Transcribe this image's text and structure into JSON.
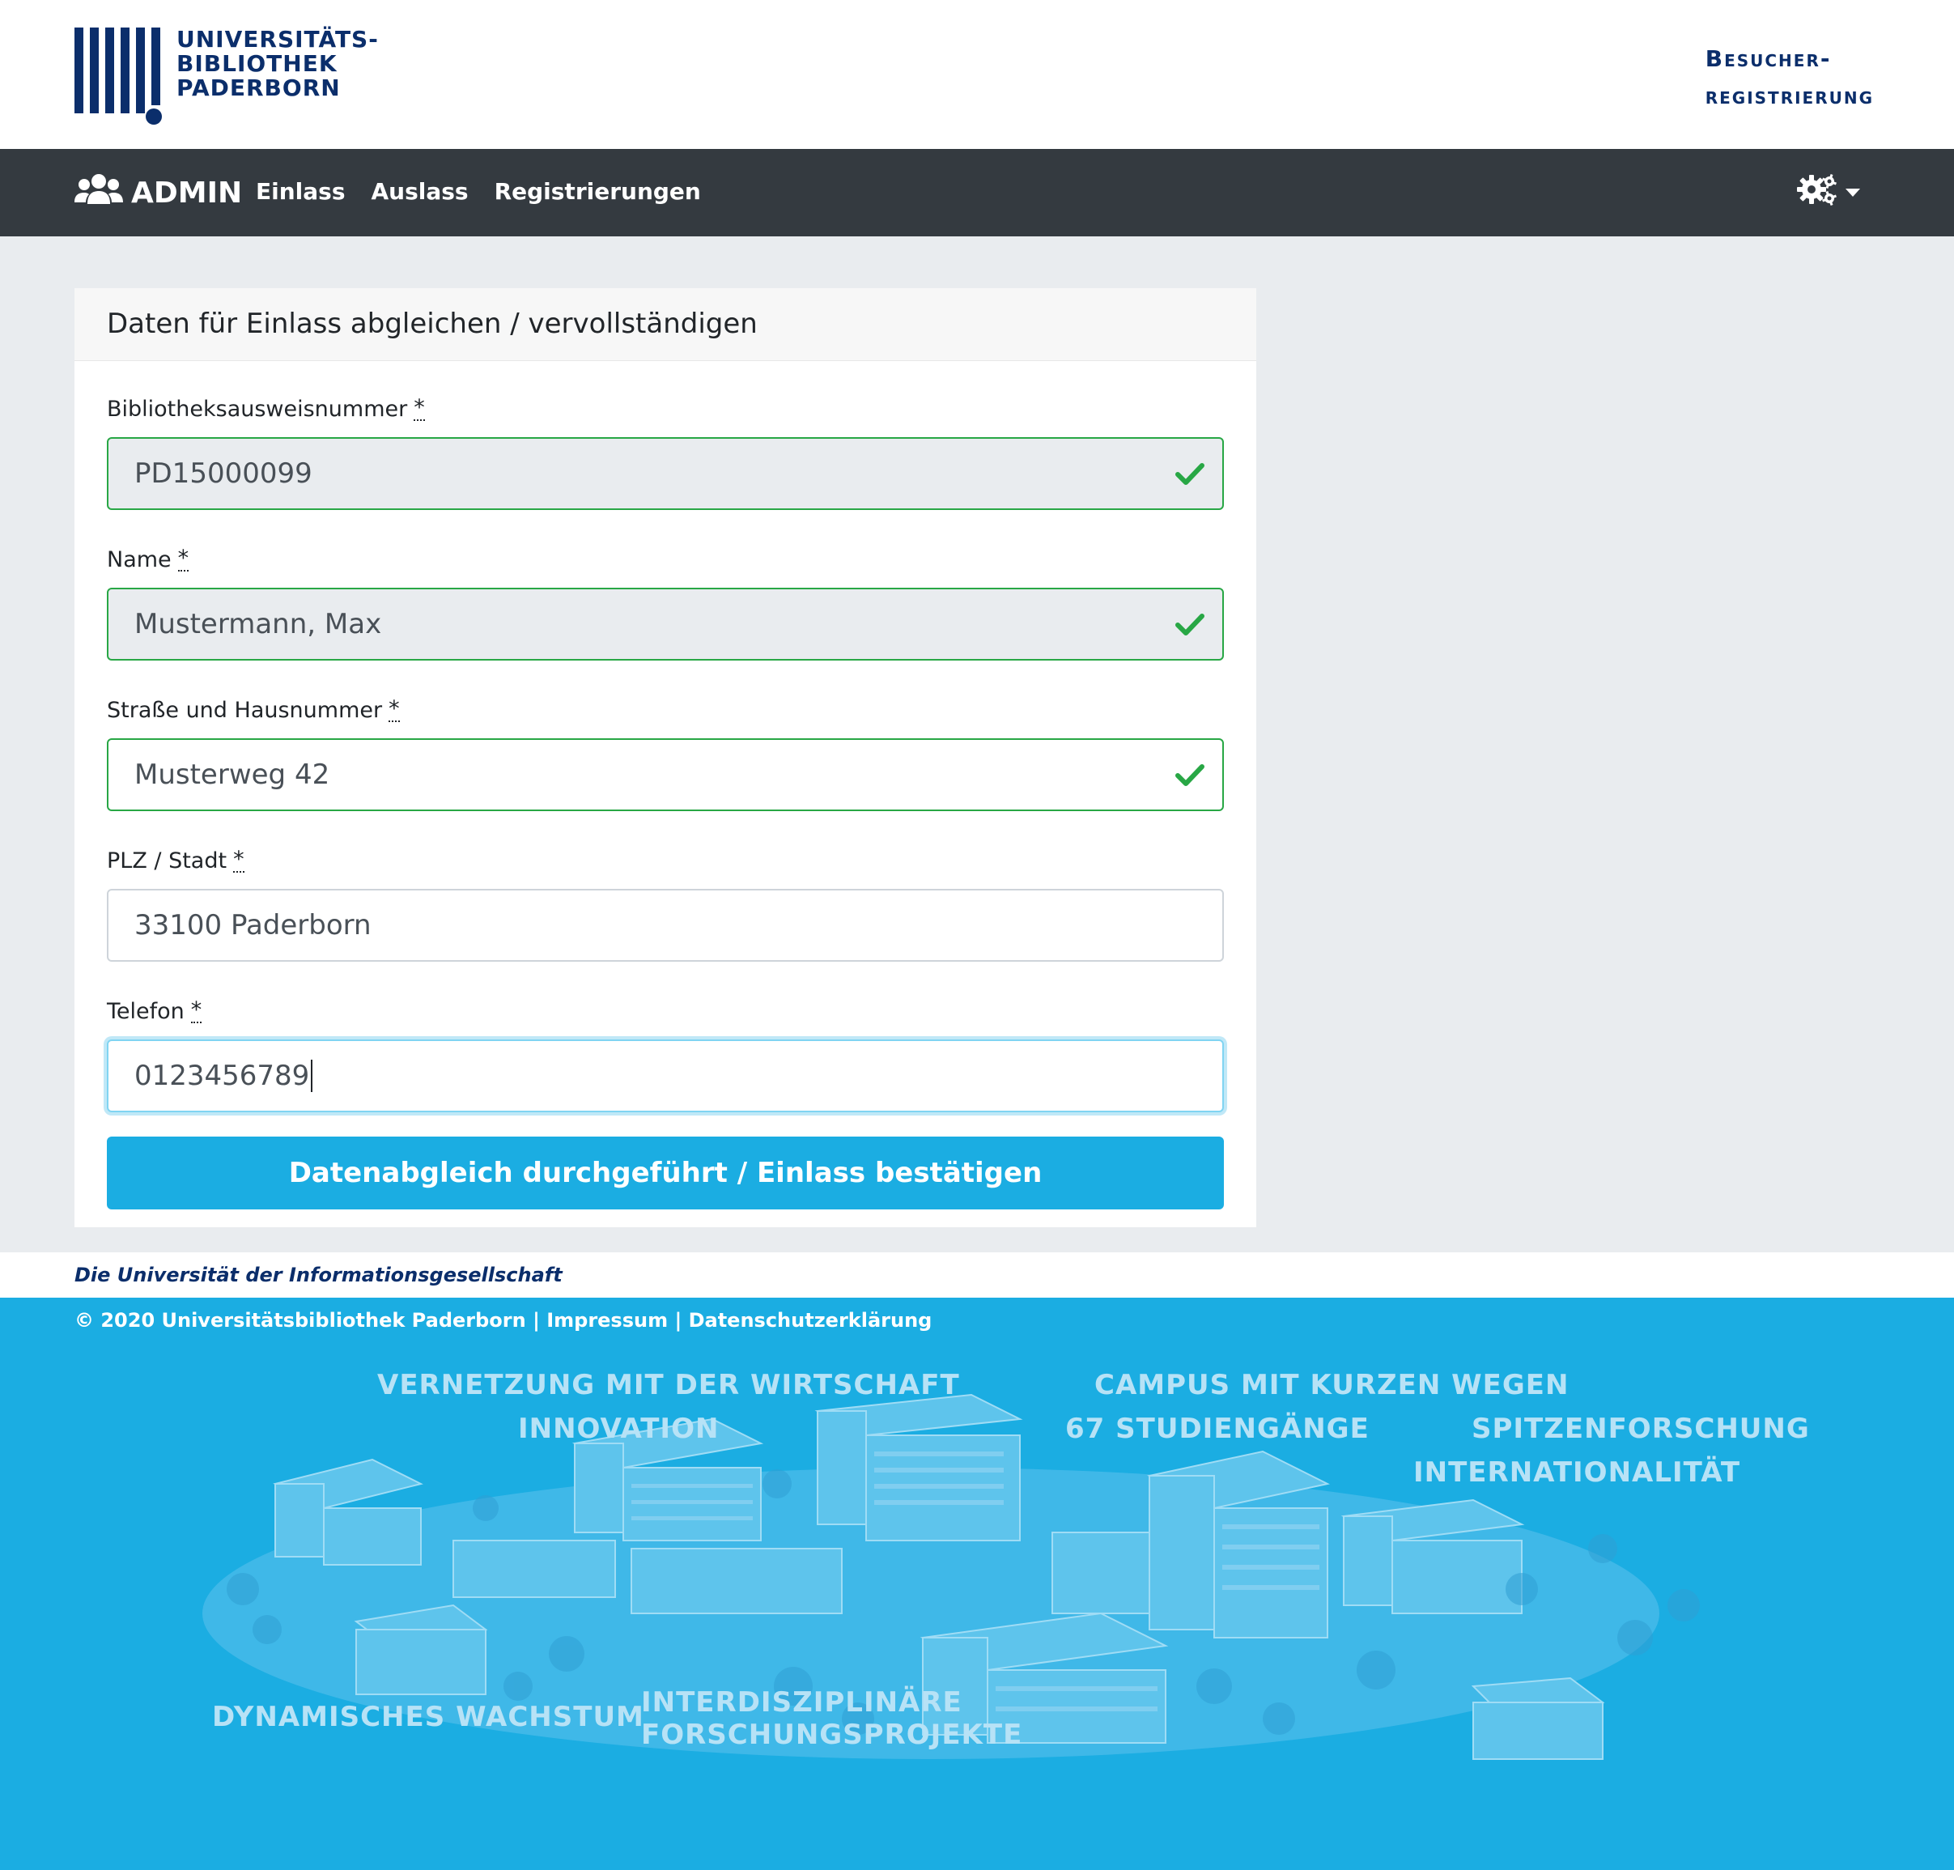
{
  "header": {
    "logo_lines": [
      "UNIVERSITÄTS-",
      "BIBLIOTHEK",
      "PADERBORN"
    ],
    "site_title_line1": "Besucher-",
    "site_title_line2": "registrierung"
  },
  "navbar": {
    "brand": "ADMIN",
    "links": [
      "Einlass",
      "Auslass",
      "Registrierungen"
    ]
  },
  "form": {
    "title": "Daten für Einlass abgleichen / vervollständigen",
    "required_marker": "*",
    "fields": [
      {
        "label": "Bibliotheksausweisnummer",
        "value": "PD15000099"
      },
      {
        "label": "Name",
        "value": "Mustermann, Max"
      },
      {
        "label": "Straße und Hausnummer",
        "value": "Musterweg 42"
      },
      {
        "label": "PLZ / Stadt",
        "value": "33100 Paderborn"
      },
      {
        "label": "Telefon",
        "value": "0123456789"
      }
    ],
    "submit_label": "Datenabgleich durchgeführt / Einlass bestätigen"
  },
  "footer": {
    "tagline": "Die Universität der Informationsgesellschaft",
    "copyright": "© 2020 Universitätsbibliothek Paderborn",
    "separator": "|",
    "impressum": "Impressum",
    "datenschutz": "Datenschutzerklärung",
    "slogans": [
      "VERNETZUNG MIT DER WIRTSCHAFT",
      "INNOVATION",
      "CAMPUS MIT KURZEN WEGEN",
      "67 STUDIENGÄNGE",
      "SPITZENFORSCHUNG",
      "INTERNATIONALITÄT",
      "DYNAMISCHES WACHSTUM",
      "INTERDISZIPLINÄRE",
      "FORSCHUNGSPROJEKTE"
    ]
  },
  "colors": {
    "brand_dark_blue": "#0b2e6b",
    "navbar": "#343a40",
    "accent_blue": "#1bade2",
    "valid_green": "#28a745"
  },
  "icons": [
    "users-icon",
    "gears-icon",
    "caret-down-icon",
    "checkmark-icon"
  ]
}
